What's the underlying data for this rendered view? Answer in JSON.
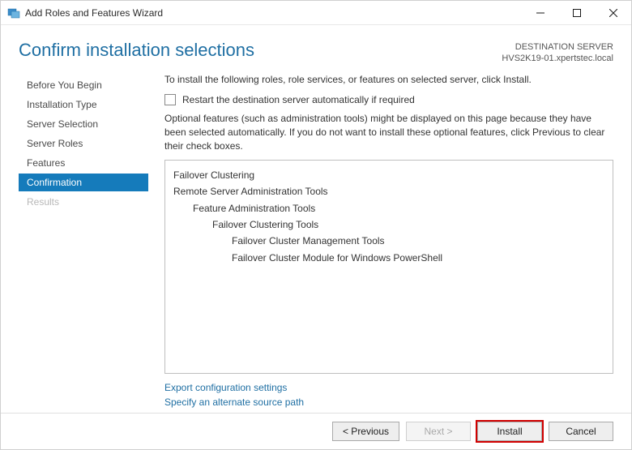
{
  "window": {
    "title": "Add Roles and Features Wizard"
  },
  "header": {
    "page_title": "Confirm installation selections",
    "dest_label": "DESTINATION SERVER",
    "dest_server": "HVS2K19-01.xpertstec.local"
  },
  "nav": {
    "items": [
      {
        "label": "Before You Begin",
        "state": "normal"
      },
      {
        "label": "Installation Type",
        "state": "normal"
      },
      {
        "label": "Server Selection",
        "state": "normal"
      },
      {
        "label": "Server Roles",
        "state": "normal"
      },
      {
        "label": "Features",
        "state": "normal"
      },
      {
        "label": "Confirmation",
        "state": "active"
      },
      {
        "label": "Results",
        "state": "disabled"
      }
    ]
  },
  "content": {
    "intro": "To install the following roles, role services, or features on selected server, click Install.",
    "restart_checkbox_label": "Restart the destination server automatically if required",
    "restart_checked": false,
    "optional_text": "Optional features (such as administration tools) might be displayed on this page because they have been selected automatically. If you do not want to install these optional features, click Previous to clear their check boxes.",
    "features_tree": [
      {
        "label": "Failover Clustering",
        "indent": 0
      },
      {
        "label": "Remote Server Administration Tools",
        "indent": 0
      },
      {
        "label": "Feature Administration Tools",
        "indent": 1
      },
      {
        "label": "Failover Clustering Tools",
        "indent": 2
      },
      {
        "label": "Failover Cluster Management Tools",
        "indent": 3
      },
      {
        "label": "Failover Cluster Module for Windows PowerShell",
        "indent": 3
      }
    ],
    "link_export": "Export configuration settings",
    "link_altsource": "Specify an alternate source path"
  },
  "buttons": {
    "previous": "< Previous",
    "next": "Next >",
    "install": "Install",
    "cancel": "Cancel"
  }
}
